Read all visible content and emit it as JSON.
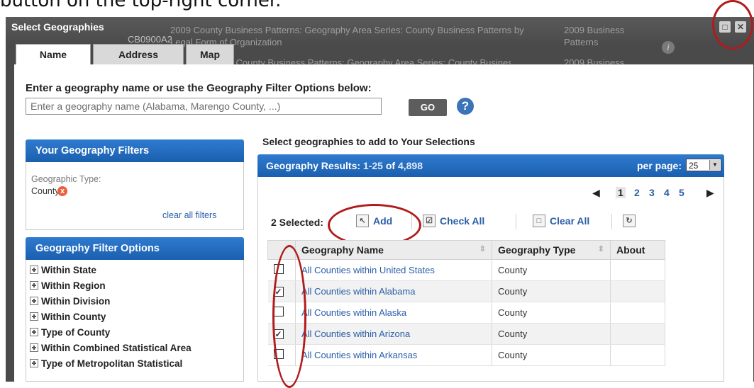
{
  "caption": "button on the top-right corner.",
  "modal": {
    "title": "Select Geographies",
    "background": {
      "code": "CB0900A2",
      "row1_title": "2009 County Business Patterns: Geography Area Series: County Business Patterns by Legal Form of Organization",
      "row1_dataset": "2009 Business Patterns",
      "row2_title": "2009 County Business Patterns: Geography Area Series: County Business",
      "row2_dataset": "2009 Business"
    },
    "info_icon_label": "i",
    "maximize_label": "□",
    "close_label": "✕"
  },
  "tabs": [
    {
      "label": "Name",
      "active": true
    },
    {
      "label": "Address",
      "active": false
    },
    {
      "label": "Map",
      "active": false
    }
  ],
  "search": {
    "prompt": "Enter a geography name or use the Geography Filter Options below:",
    "placeholder": "Enter a geography name (Alabama, Marengo County, ...)",
    "go_label": "GO",
    "help_label": "?"
  },
  "filters": {
    "title": "Your Geography Filters",
    "type_label": "Geographic Type:",
    "type_value": "County",
    "remove_label": "x",
    "clear_all": "clear all filters"
  },
  "filter_options": {
    "title": "Geography Filter Options",
    "items": [
      "Within State",
      "Within Region",
      "Within Division",
      "Within County",
      "Type of County",
      "Within Combined Statistical Area",
      "Type of Metropolitan Statistical"
    ]
  },
  "results": {
    "instruction": "Select geographies to add to Your Selections",
    "header_label": "Geography Results:",
    "range": "1-25",
    "of_label": "of",
    "total": "4,898",
    "per_page_label": "per page:",
    "per_page_value": "25",
    "pages": [
      "1",
      "2",
      "3",
      "4",
      "5"
    ],
    "current_page": "1",
    "selected_count": "2 Selected:",
    "add_label": "Add",
    "check_all_label": "Check All",
    "clear_all_label": "Clear All",
    "columns": [
      "Geography Name",
      "Geography Type",
      "About"
    ],
    "rows": [
      {
        "name": "All Counties within United States",
        "type": "County",
        "checked": false
      },
      {
        "name": "All Counties within Alabama",
        "type": "County",
        "checked": true
      },
      {
        "name": "All Counties within Alaska",
        "type": "County",
        "checked": false
      },
      {
        "name": "All Counties within Arizona",
        "type": "County",
        "checked": true
      },
      {
        "name": "All Counties within Arkansas",
        "type": "County",
        "checked": false
      }
    ]
  },
  "annotation_color": "#b11b1b"
}
